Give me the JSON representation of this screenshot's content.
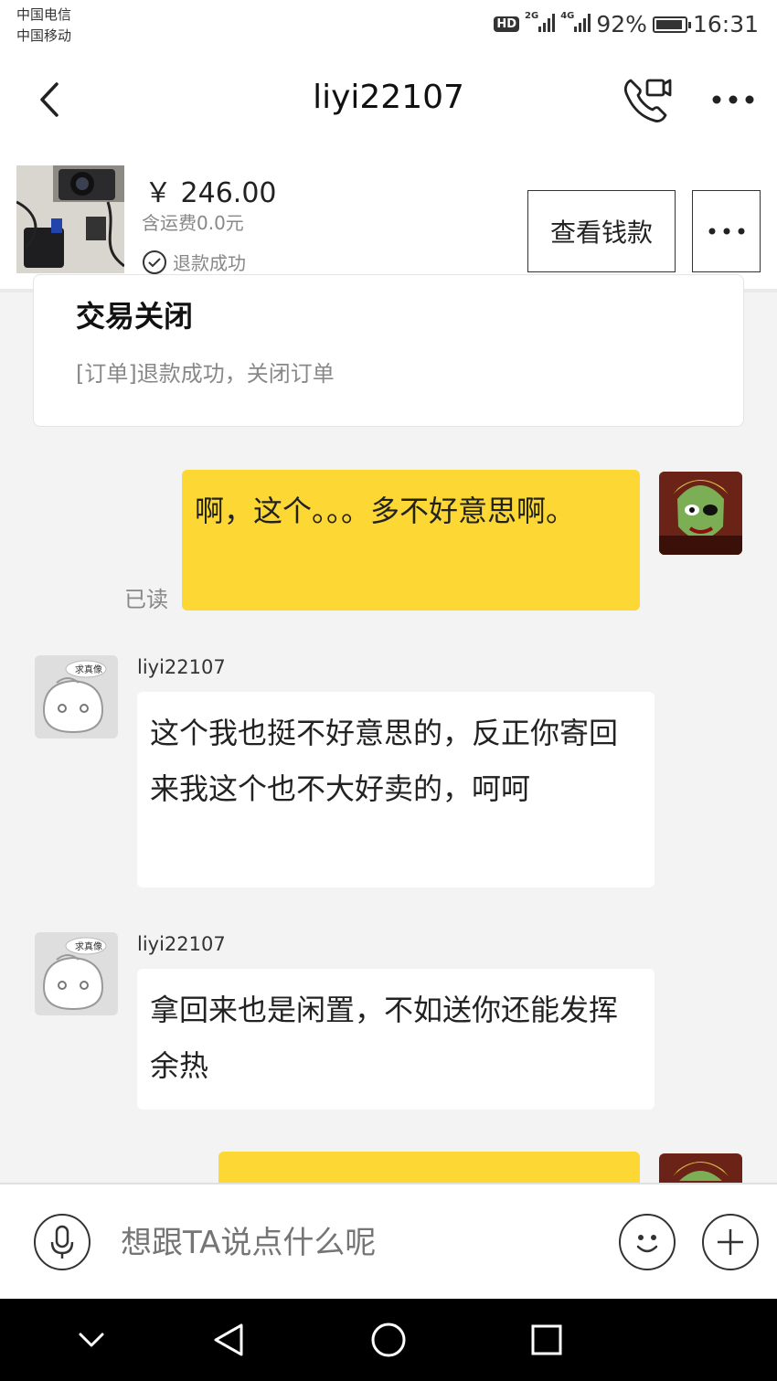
{
  "status_bar": {
    "carrier_1": "中国电信",
    "carrier_2": "中国移动",
    "hd": "HD",
    "net_1": "2G",
    "net_2": "4G",
    "battery": "92%",
    "battery_level": 0.92,
    "time": "16:31"
  },
  "header": {
    "title": "liyi22107"
  },
  "product": {
    "price": "￥ 246.00",
    "shipping": "含运费0.0元",
    "status": "退款成功",
    "view_money_label": "查看钱款"
  },
  "order_card": {
    "title": "交易关闭",
    "desc": "[订单]退款成功，关闭订单"
  },
  "messages": [
    {
      "from": "me",
      "text": "啊，这个。。。多不好意思啊。",
      "read": "已读"
    },
    {
      "from": "other",
      "nick": "liyi22107",
      "text": "这个我也挺不好意思的，反正你寄回来我这个也不大好卖的，呵呵",
      "avatar_badge": "求真像"
    },
    {
      "from": "other",
      "nick": "liyi22107",
      "text": "拿回来也是闲置，不如送你还能发挥余热",
      "avatar_badge": "求真像"
    }
  ],
  "input": {
    "placeholder": "想跟TA说点什么呢"
  },
  "colors": {
    "my_bubble": "#fdd835",
    "background": "#f3f3f3"
  }
}
